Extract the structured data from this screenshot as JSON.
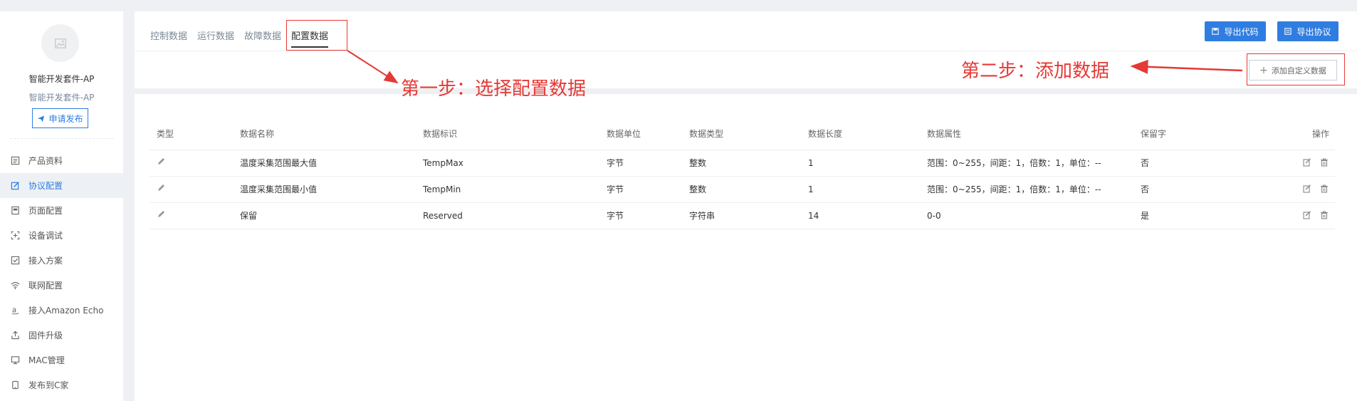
{
  "sidebar": {
    "product_name": "智能开发套件-AP",
    "product_subtitle": "智能开发套件-AP",
    "publish_label": "申请发布",
    "items": [
      {
        "label": "产品资料",
        "icon": "document-icon"
      },
      {
        "label": "协议配置",
        "icon": "edit-icon"
      },
      {
        "label": "页面配置",
        "icon": "page-icon"
      },
      {
        "label": "设备调试",
        "icon": "debug-icon"
      },
      {
        "label": "接入方案",
        "icon": "checkbox-icon"
      },
      {
        "label": "联网配置",
        "icon": "wifi-icon"
      },
      {
        "label": "接入Amazon Echo",
        "icon": "amazon-icon"
      },
      {
        "label": "固件升级",
        "icon": "upload-icon"
      },
      {
        "label": "MAC管理",
        "icon": "monitor-icon"
      },
      {
        "label": "发布到C家",
        "icon": "phone-icon"
      }
    ],
    "active_index": 1
  },
  "header": {
    "tabs": [
      "控制数据",
      "运行数据",
      "故障数据",
      "配置数据"
    ],
    "active_tab": 3,
    "export_code_label": "导出代码",
    "export_protocol_label": "导出协议",
    "add_custom_label": "添加自定义数据"
  },
  "table": {
    "columns": [
      "类型",
      "数据名称",
      "数据标识",
      "数据单位",
      "数据类型",
      "数据长度",
      "数据属性",
      "保留字",
      "操作"
    ],
    "rows": [
      {
        "name": "温度采集范围最大值",
        "id": "TempMax",
        "unit": "字节",
        "dtype": "整数",
        "length": "1",
        "attr": "范围：0~255，间距：1，倍数：1，单位：--",
        "reserved": "否"
      },
      {
        "name": "温度采集范围最小值",
        "id": "TempMin",
        "unit": "字节",
        "dtype": "整数",
        "length": "1",
        "attr": "范围：0~255，间距：1，倍数：1，单位：--",
        "reserved": "否"
      },
      {
        "name": "保留",
        "id": "Reserved",
        "unit": "字节",
        "dtype": "字符串",
        "length": "14",
        "attr": "0-0",
        "reserved": "是"
      }
    ]
  },
  "annotations": {
    "step1": "第一步：选择配置数据",
    "step2": "第二步：添加数据",
    "color": "#e53935"
  },
  "colors": {
    "accent": "#2f7de1",
    "background": "#eef0f3"
  }
}
